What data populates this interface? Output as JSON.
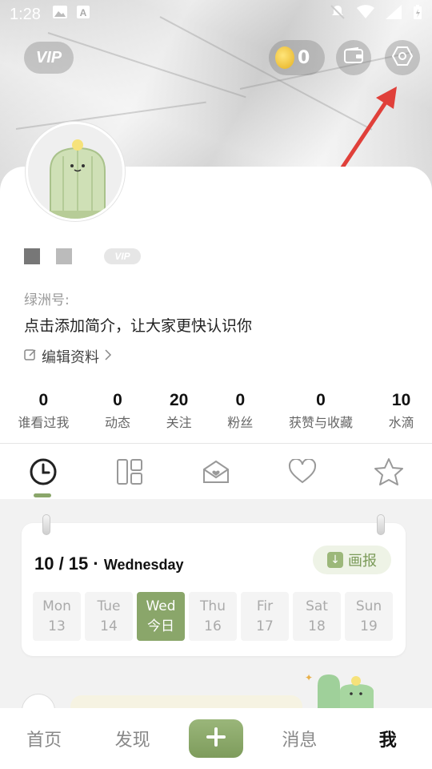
{
  "status_bar": {
    "time": "1:28"
  },
  "header": {
    "vip_label": "VIP",
    "coin_count": "0"
  },
  "profile": {
    "vip_badge": "VIP",
    "oasis_id_label": "绿洲号:",
    "bio": "点击添加简介，让大家更快认识你",
    "edit_label": "编辑资料"
  },
  "stats": [
    {
      "value": "0",
      "label": "谁看过我"
    },
    {
      "value": "0",
      "label": "动态"
    },
    {
      "value": "20",
      "label": "关注"
    },
    {
      "value": "0",
      "label": "粉丝"
    },
    {
      "value": "0",
      "label": "获赞与收藏"
    },
    {
      "value": "10",
      "label": "水滴"
    }
  ],
  "tabs": [
    {
      "icon": "clock-icon"
    },
    {
      "icon": "grid-icon"
    },
    {
      "icon": "envelope-heart-icon"
    },
    {
      "icon": "heart-icon"
    },
    {
      "icon": "star-icon"
    }
  ],
  "calendar": {
    "date": "10 / 15",
    "weekday": "Wednesday",
    "huabao_label": "画报",
    "days": [
      {
        "name": "Mon",
        "num": "13"
      },
      {
        "name": "Tue",
        "num": "14"
      },
      {
        "name": "Wed",
        "num": "今日"
      },
      {
        "name": "Thu",
        "num": "16"
      },
      {
        "name": "Fir",
        "num": "17"
      },
      {
        "name": "Sat",
        "num": "18"
      },
      {
        "name": "Sun",
        "num": "19"
      }
    ]
  },
  "bottom_nav": {
    "home": "首页",
    "discover": "发现",
    "messages": "消息",
    "me": "我"
  },
  "colors": {
    "accent": "#8aa66a",
    "arrow": "#e0403a"
  }
}
